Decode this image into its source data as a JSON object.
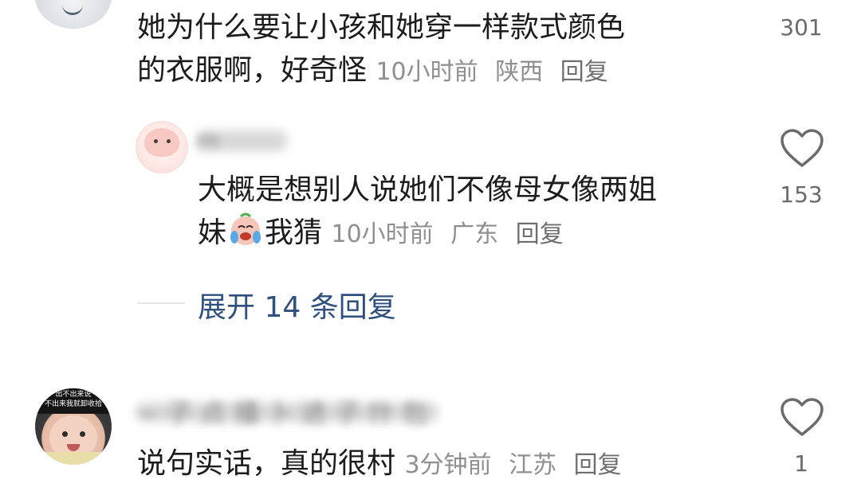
{
  "comments": [
    {
      "text_line1": "她为什么要让小孩和她穿一样款式颜色",
      "text_line2": "的衣服啊，好奇怪",
      "time": "10小时前",
      "location": "陕西",
      "reply_label": "回复",
      "likes": "301"
    },
    {
      "username": "m",
      "text_line1": "大概是想别人说她们不像母女像两姐",
      "text_line2_pre": "妹",
      "text_line2_emoji": "crying-laughing-emoji",
      "text_line2_post": "我猜",
      "time": "10小时前",
      "location": "广东",
      "reply_label": "回复",
      "likes": "153"
    },
    {
      "username": "~ 子 点 播 卜 进 子      什 包",
      "avatar_caption_1": "出不出来说",
      "avatar_caption_2": "不出来我就卸收拾",
      "text": "说句实话，真的很村",
      "time": "3分钟前",
      "location": "江苏",
      "reply_label": "回复",
      "likes": "1"
    }
  ],
  "expand": {
    "label": "展开 14 条回复"
  },
  "colors": {
    "text": "#1c1c1c",
    "meta": "#8f8f8f",
    "link": "#2f4f7f",
    "heart_stroke": "#6b6b6b"
  }
}
